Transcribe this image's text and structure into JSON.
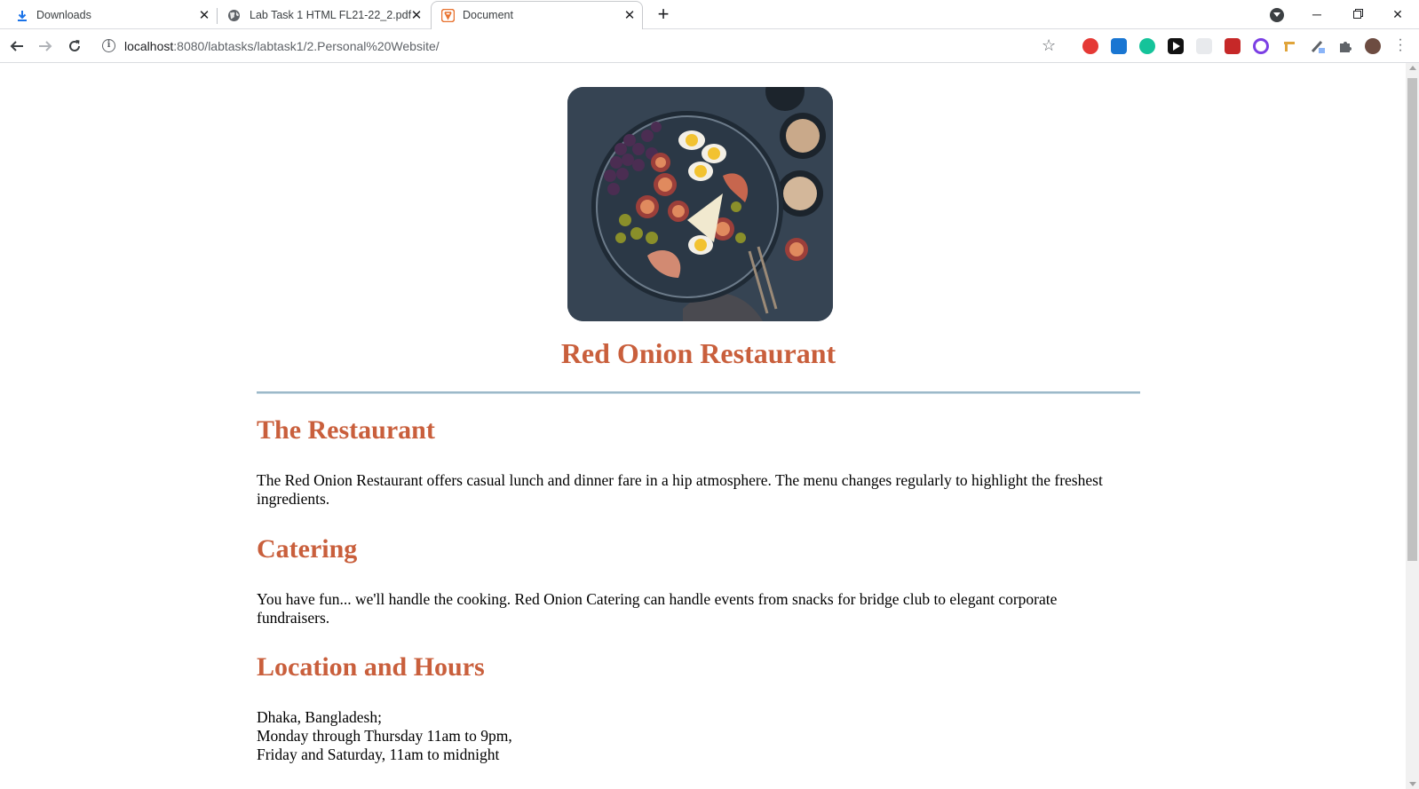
{
  "browser": {
    "tabs": [
      {
        "title": "Downloads",
        "icon": "download-icon"
      },
      {
        "title": "Lab Task 1 HTML FL21-22_2.pdf",
        "icon": "globe-icon"
      },
      {
        "title": "Document",
        "icon": "html5-icon",
        "active": true
      }
    ],
    "new_tab_label": "+",
    "address": {
      "host": "localhost",
      "path": ":8080/labtasks/labtask1/2.Personal%20Website/"
    },
    "accent": "#1a73e8"
  },
  "page": {
    "hero_image_alt": "food platter",
    "title": "Red Onion Restaurant",
    "title_color": "#c95f3c",
    "sections": [
      {
        "heading": "The Restaurant",
        "lines": [
          "The Red Onion Restaurant offers casual lunch and dinner fare in a hip atmosphere. The menu changes regularly to highlight the freshest",
          "ingredients."
        ]
      },
      {
        "heading": "Catering",
        "lines": [
          "You have fun... we'll handle the cooking. Red Onion Catering can handle events from snacks for bridge club to elegant corporate",
          "fundraisers."
        ]
      },
      {
        "heading": "Location and Hours",
        "lines": [
          "Dhaka, Bangladesh;",
          "Monday through Thursday 11am to 9pm,",
          "Friday and Saturday, 11am to midnight"
        ]
      }
    ]
  }
}
